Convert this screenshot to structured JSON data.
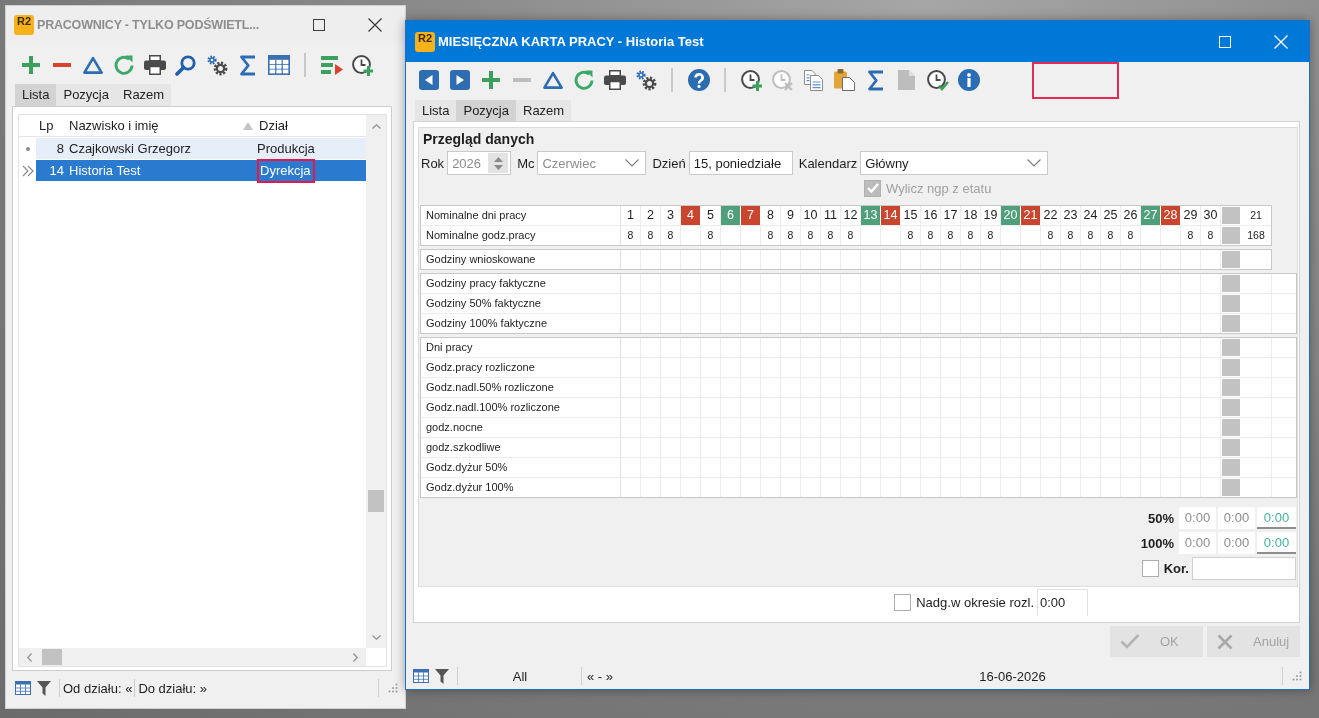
{
  "employees_window": {
    "logo": "R2",
    "title": "PRACOWNICY - TYLKO PODŚWIETL...",
    "active": false,
    "toolbar": [
      {
        "kind": "add",
        "disabled": false
      },
      {
        "kind": "remove",
        "disabled": false
      },
      {
        "kind": "edit",
        "disabled": false
      },
      {
        "kind": "refresh",
        "disabled": false
      },
      {
        "kind": "print",
        "disabled": false
      },
      {
        "kind": "search",
        "disabled": false
      },
      {
        "kind": "settings",
        "disabled": false
      },
      {
        "kind": "sum",
        "disabled": false
      },
      {
        "kind": "columns",
        "disabled": false
      },
      {
        "kind": "separator"
      },
      {
        "kind": "run",
        "disabled": false
      },
      {
        "kind": "clock-add",
        "disabled": false
      }
    ],
    "tabs": [
      {
        "label": "Lista",
        "selected": true
      },
      {
        "label": "Pozycja",
        "selected": false
      },
      {
        "label": "Razem",
        "selected": false
      }
    ],
    "table": {
      "columns": [
        {
          "label": "Lp",
          "sorted": false
        },
        {
          "label": "Nazwisko i imię",
          "sorted": true
        },
        {
          "label": "Dział",
          "sorted": false
        }
      ],
      "rows": [
        {
          "selected": false,
          "cells": [
            {
              "text": "8",
              "marked": false
            },
            {
              "text": "Czajkowski Grzegorz",
              "marked": false
            },
            {
              "text": "Produkcja",
              "marked": false
            }
          ]
        },
        {
          "selected": true,
          "cells": [
            {
              "text": "14",
              "marked": false
            },
            {
              "text": "Historia Test",
              "marked": false
            },
            {
              "text": "Dyrekcja",
              "marked": true
            }
          ]
        }
      ]
    },
    "status_bar": [
      "Od działu: «",
      "Do działu: »"
    ]
  },
  "timesheet_window": {
    "logo": "R2",
    "title": "MIESIĘCZNA KARTA PRACY - Historia Test",
    "active": true,
    "toolbar": [
      {
        "kind": "prev",
        "disabled": false
      },
      {
        "kind": "next",
        "disabled": false
      },
      {
        "kind": "add",
        "disabled": false
      },
      {
        "kind": "remove",
        "disabled": true
      },
      {
        "kind": "edit",
        "disabled": false
      },
      {
        "kind": "refresh",
        "disabled": false
      },
      {
        "kind": "print",
        "disabled": false
      },
      {
        "kind": "settings",
        "disabled": false
      },
      {
        "kind": "separator"
      },
      {
        "kind": "help",
        "disabled": false
      },
      {
        "kind": "separator"
      },
      {
        "kind": "clock-add",
        "disabled": false
      },
      {
        "kind": "clock-remove",
        "disabled": true
      },
      {
        "kind": "copy",
        "disabled": false
      },
      {
        "kind": "paste",
        "disabled": false
      },
      {
        "kind": "sum",
        "disabled": false
      },
      {
        "kind": "document",
        "disabled": true
      },
      {
        "kind": "clock-check",
        "disabled": false
      },
      {
        "kind": "info",
        "disabled": false
      }
    ],
    "highlight_frame": true,
    "tabs": [
      {
        "label": "Lista",
        "selected": false
      },
      {
        "label": "Pozycja",
        "selected": true
      },
      {
        "label": "Razem",
        "selected": false
      }
    ],
    "panel_title": "Przegląd danych",
    "fields": [
      {
        "kind": "spin",
        "label": "Rok",
        "value": "2026",
        "disabled": true
      },
      {
        "kind": "dropdown",
        "label": "Mc",
        "value": "Czerwiec",
        "disabled": true
      },
      {
        "kind": "text",
        "label": "Dzień",
        "value": "15, poniedziałe",
        "disabled": false
      },
      {
        "kind": "dropdown",
        "label": "Kalendarz",
        "value": "Główny",
        "disabled": false
      }
    ],
    "ngp_checkbox": {
      "label": "Wylicz ngp z etatu",
      "checked": true,
      "disabled": true
    },
    "calendar": {
      "nominal_rows": [
        {
          "kind": "days",
          "label": "Nominalne dni pracy",
          "total": "21"
        },
        {
          "kind": "hours",
          "label": "Nominalne godz.pracy",
          "total": "168"
        }
      ],
      "days": [
        {
          "day": "1",
          "kind": "workday",
          "hours": "8"
        },
        {
          "day": "2",
          "kind": "workday",
          "hours": "8"
        },
        {
          "day": "3",
          "kind": "workday",
          "hours": "8"
        },
        {
          "day": "4",
          "kind": "holiday"
        },
        {
          "day": "5",
          "kind": "workday",
          "hours": "8"
        },
        {
          "day": "6",
          "kind": "dayoff"
        },
        {
          "day": "7",
          "kind": "holiday"
        },
        {
          "day": "8",
          "kind": "workday",
          "hours": "8"
        },
        {
          "day": "9",
          "kind": "workday",
          "hours": "8"
        },
        {
          "day": "10",
          "kind": "workday",
          "hours": "8"
        },
        {
          "day": "11",
          "kind": "workday",
          "hours": "8"
        },
        {
          "day": "12",
          "kind": "workday",
          "hours": "8"
        },
        {
          "day": "13",
          "kind": "dayoff"
        },
        {
          "day": "14",
          "kind": "holiday"
        },
        {
          "day": "15",
          "kind": "workday",
          "hours": "8"
        },
        {
          "day": "16",
          "kind": "workday",
          "hours": "8"
        },
        {
          "day": "17",
          "kind": "workday",
          "hours": "8"
        },
        {
          "day": "18",
          "kind": "workday",
          "hours": "8"
        },
        {
          "day": "19",
          "kind": "workday",
          "hours": "8"
        },
        {
          "day": "20",
          "kind": "dayoff"
        },
        {
          "day": "21",
          "kind": "holiday"
        },
        {
          "day": "22",
          "kind": "workday",
          "hours": "8"
        },
        {
          "day": "23",
          "kind": "workday",
          "hours": "8"
        },
        {
          "day": "24",
          "kind": "workday",
          "hours": "8"
        },
        {
          "day": "25",
          "kind": "workday",
          "hours": "8"
        },
        {
          "day": "26",
          "kind": "workday",
          "hours": "8"
        },
        {
          "day": "27",
          "kind": "dayoff"
        },
        {
          "day": "28",
          "kind": "holiday"
        },
        {
          "day": "29",
          "kind": "workday",
          "hours": "8"
        },
        {
          "day": "30",
          "kind": "workday",
          "hours": "8"
        }
      ],
      "sections": [
        {
          "kind": "requested",
          "rows": [
            "Godziny wnioskowane"
          ]
        },
        {
          "kind": "actual",
          "rows": [
            "Godziny pracy faktyczne",
            "Godziny 50% faktyczne",
            "Godziny 100% faktyczne"
          ]
        },
        {
          "kind": "settled",
          "rows": [
            "Dni pracy",
            "Godz.pracy rozliczone",
            "Godz.nadl.50% rozliczone",
            "Godz.nadl.100% rozliczone",
            "godz.nocne",
            "godz.szkodliwe",
            "Godz.dyżur 50%",
            "Godz.dyżur 100%"
          ]
        }
      ]
    },
    "summary": [
      {
        "label": "50%",
        "values": [
          "0:00",
          "0:00"
        ],
        "input": "0:00"
      },
      {
        "label": "100%",
        "values": [
          "0:00",
          "0:00"
        ],
        "input": "0:00"
      }
    ],
    "correction": {
      "label": "Kor.",
      "checked": false
    },
    "settlement": {
      "label": "Nadg.w okresie rozl.",
      "checked": false,
      "value": "0:00"
    },
    "buttons": [
      {
        "kind": "ok",
        "label": "OK",
        "disabled": true
      },
      {
        "kind": "cancel",
        "label": "Anuluj",
        "disabled": true
      }
    ],
    "status_bar": {
      "filter": "All",
      "range": "« - »",
      "date": "16-06-2026"
    }
  }
}
